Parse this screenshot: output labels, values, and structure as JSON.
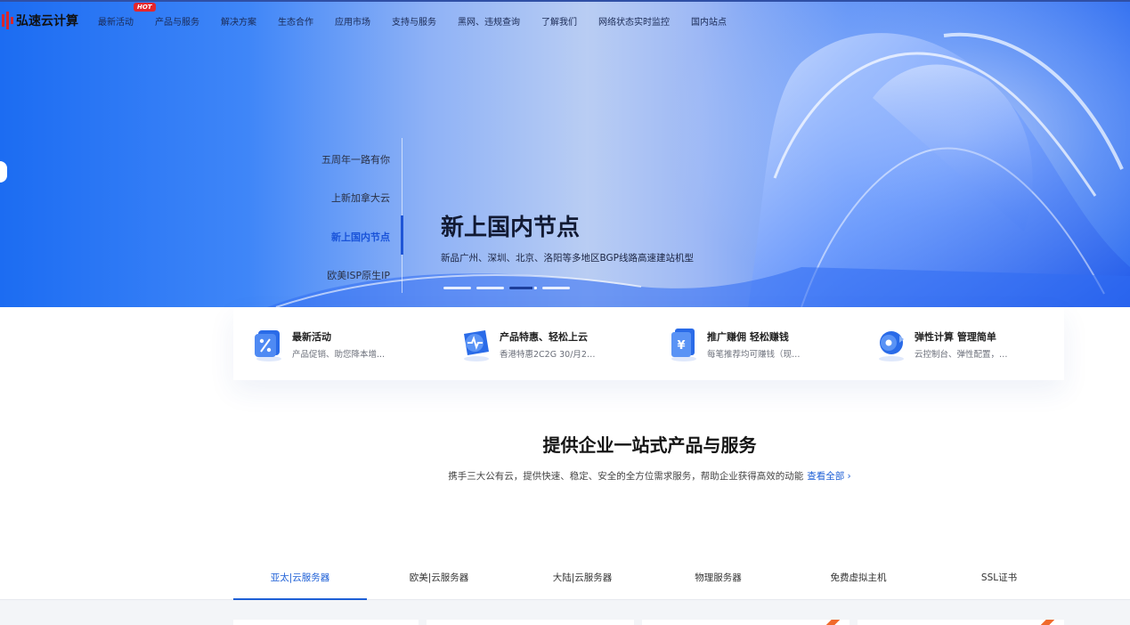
{
  "nav": {
    "logo_text": "弘速云计算",
    "hot_badge": "HOT",
    "items": [
      "最新活动",
      "产品与服务",
      "解决方案",
      "生态合作",
      "应用市场",
      "支持与服务",
      "黑网、违规查询",
      "了解我们",
      "网络状态实时监控",
      "国内站点"
    ]
  },
  "hero": {
    "menu": [
      "五周年一路有你",
      "上新加拿大云",
      "新上国内节点",
      "欧美ISP原生IP"
    ],
    "active_index": 2,
    "title": "新上国内节点",
    "subtitle": "新品广州、深圳、北京、洛阳等多地区BGP线路高速建站机型",
    "slide_count": 4,
    "active_slide": 2
  },
  "features": [
    {
      "title": "最新活动",
      "desc": "产品促销、助您降本增...",
      "icon": "discount-icon"
    },
    {
      "title": "产品特惠、轻松上云",
      "desc": "香港特惠2C2G 30/月230...",
      "icon": "monitor-pulse-icon"
    },
    {
      "title": "推广赚佣 轻松赚钱",
      "desc": "每笔推荐均可赚钱（现金返佣...",
      "icon": "yen-shield-icon"
    },
    {
      "title": "弹性计算 管理简单",
      "desc": "云控制台、弹性配置，灵活管...",
      "icon": "gear-cloud-icon"
    }
  ],
  "section": {
    "title": "提供企业一站式产品与服务",
    "subtitle": "携手三大公有云，提供快速、稳定、安全的全方位需求服务，帮助企业获得高效的动能",
    "link": "查看全部 ›"
  },
  "tabs": [
    "亚太|云服务器",
    "欧美|云服务器",
    "大陆|云服务器",
    "物理服务器",
    "免费虚拟主机",
    "SSL证书"
  ],
  "colors": {
    "accent": "#1d5fd6",
    "hot": "#e4262c",
    "logo_red": "#d7262c"
  }
}
